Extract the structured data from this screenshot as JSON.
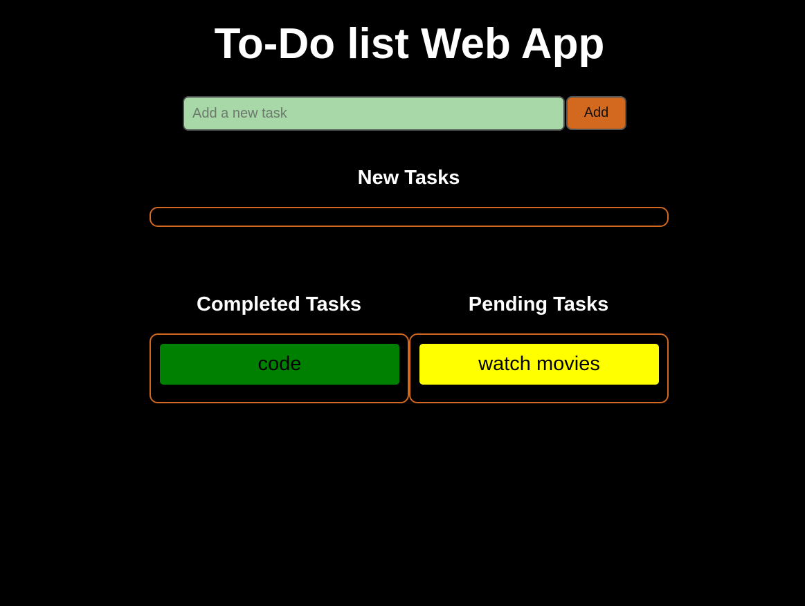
{
  "header": {
    "title": "To-Do list Web App"
  },
  "input": {
    "placeholder": "Add a new task",
    "value": ""
  },
  "add_button": {
    "label": "Add"
  },
  "sections": {
    "new": {
      "heading": "New Tasks",
      "tasks": []
    },
    "completed": {
      "heading": "Completed Tasks",
      "tasks": [
        "code"
      ]
    },
    "pending": {
      "heading": "Pending Tasks",
      "tasks": [
        "watch movies"
      ]
    }
  },
  "colors": {
    "background": "#000000",
    "accent": "#d2691e",
    "input_bg": "#a8d8a8",
    "completed_task": "#008000",
    "pending_task": "#ffff00"
  }
}
